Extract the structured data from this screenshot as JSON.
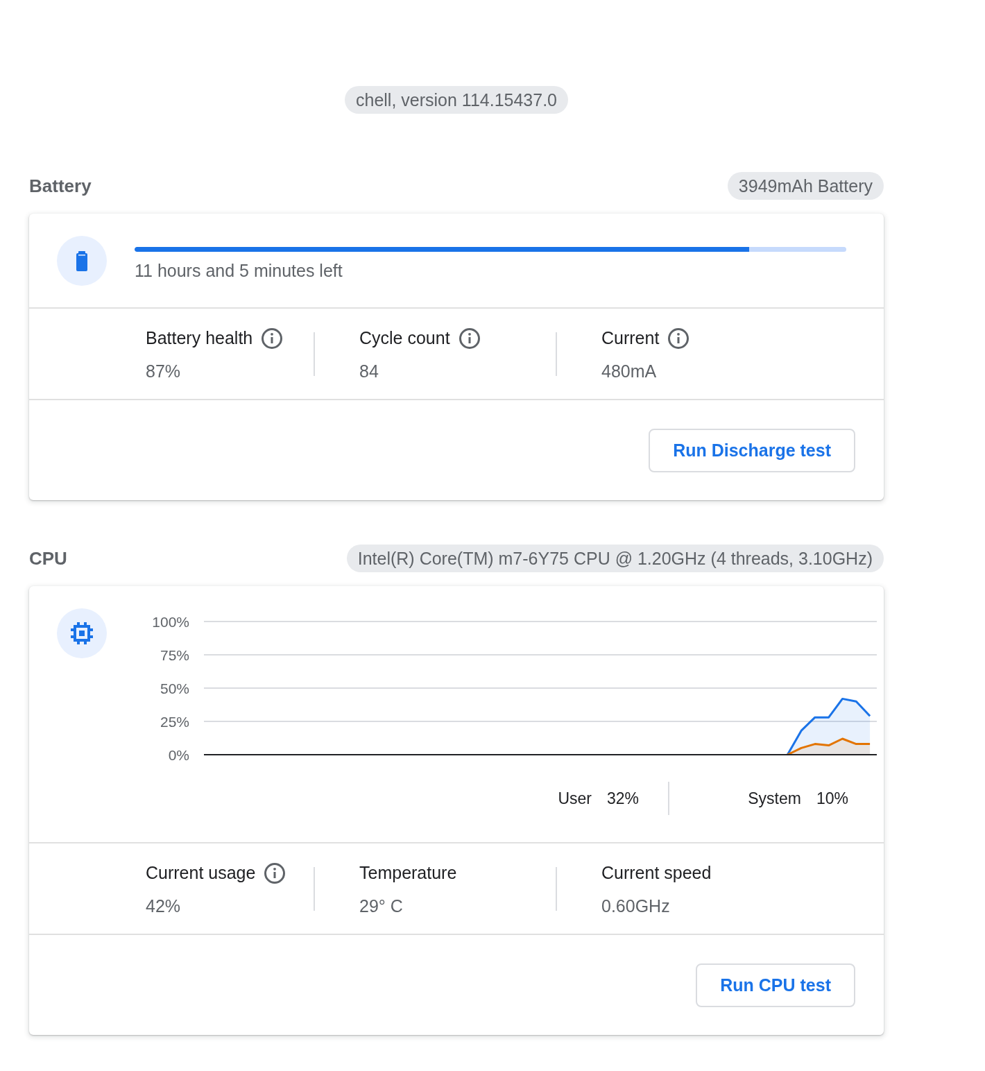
{
  "version_chip": "chell, version 114.15437.0",
  "sections": [
    {
      "kind": "battery",
      "title": "Battery",
      "chip": "3949mAh Battery",
      "progress": {
        "level": 0.864,
        "label": "11 hours and 5 minutes left"
      },
      "stats": [
        {
          "label": "Battery health",
          "value": "87%",
          "info_icon": true
        },
        {
          "label": "Cycle count",
          "value": "84",
          "info_icon": true
        },
        {
          "label": "Current",
          "value": "480mA",
          "info_icon": true
        }
      ],
      "button": "Run Discharge test"
    },
    {
      "kind": "cpu",
      "title": "CPU",
      "chip": "Intel(R) Core(TM) m7-6Y75 CPU @ 1.20GHz (4 threads, 3.10GHz)",
      "chart_data": {
        "type": "area",
        "grid": true,
        "categories": [
          null,
          null,
          null,
          null,
          null,
          null,
          null,
          null,
          null,
          null,
          null,
          null,
          null,
          null,
          null,
          null,
          null,
          null,
          null,
          null,
          null,
          null,
          null,
          null,
          null,
          null,
          null,
          null,
          null,
          null,
          null,
          null,
          null,
          null,
          null,
          null,
          null,
          null,
          null,
          null,
          null,
          null,
          null,
          null,
          null,
          null,
          null,
          null,
          null
        ],
        "ylim": [
          0,
          100
        ],
        "yticks": [
          {
            "value": 0,
            "label": "0%"
          },
          {
            "value": 25,
            "label": "25%"
          },
          {
            "value": 50,
            "label": "50%"
          },
          {
            "value": 75,
            "label": "75%"
          },
          {
            "value": 100,
            "label": "100%"
          }
        ],
        "series": [
          {
            "name": "User",
            "color": "#1a73e8",
            "values": [
              null,
              null,
              null,
              null,
              null,
              null,
              null,
              null,
              null,
              null,
              null,
              null,
              null,
              null,
              null,
              null,
              null,
              null,
              null,
              null,
              null,
              null,
              null,
              null,
              null,
              null,
              null,
              null,
              null,
              null,
              null,
              null,
              null,
              null,
              null,
              null,
              null,
              null,
              null,
              null,
              null,
              null,
              0,
              18,
              28,
              28,
              42,
              40,
              29
            ]
          },
          {
            "name": "System",
            "color": "#e37400",
            "values": [
              null,
              null,
              null,
              null,
              null,
              null,
              null,
              null,
              null,
              null,
              null,
              null,
              null,
              null,
              null,
              null,
              null,
              null,
              null,
              null,
              null,
              null,
              null,
              null,
              null,
              null,
              null,
              null,
              null,
              null,
              null,
              null,
              null,
              null,
              null,
              null,
              null,
              null,
              null,
              null,
              null,
              null,
              0,
              5,
              8,
              7,
              12,
              8,
              8
            ]
          }
        ]
      },
      "legend": [
        {
          "reading": "32%"
        },
        {
          "reading": "10%"
        }
      ],
      "stats": [
        {
          "label": "Current usage",
          "value": "42%",
          "info_icon": true
        },
        {
          "label": "Temperature",
          "value": "29° C",
          "info_icon": false
        },
        {
          "label": "Current speed",
          "value": "0.60GHz",
          "info_icon": false
        }
      ],
      "button": "Run CPU test"
    }
  ]
}
